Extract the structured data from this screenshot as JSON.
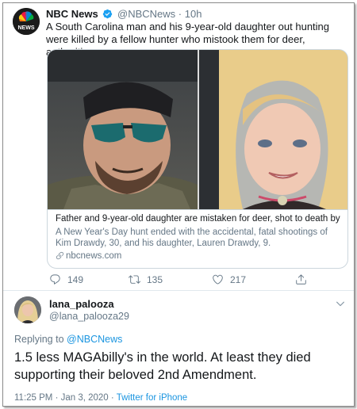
{
  "quoted_tweet": {
    "account_name": "NBC News",
    "handle": "@NBCNews",
    "separator": "·",
    "time": "10h",
    "logo_text": "NEWS",
    "text": "A South Carolina man and his 9-year-old daughter out hunting were killed by a fellow hunter who mistook them for deer, authorities say.",
    "card": {
      "title": "Father and 9-year-old daughter are mistaken for deer, shot to death by ...",
      "description": "A New Year's Day hunt ended with the accidental, fatal shootings of Kim Drawdy, 30, and his daughter, Lauren Drawdy, 9.",
      "link": "nbcnews.com"
    },
    "actions": {
      "replies": "149",
      "retweets": "135",
      "likes": "217"
    }
  },
  "reply_tweet": {
    "display_name": "lana_palooza",
    "handle": "@lana_palooza29",
    "replying_prefix": "Replying to",
    "replying_to": "@NBCNews",
    "text": "1.5 less MAGAbilly's in the world. At least they died supporting their beloved 2nd Amendment.",
    "timestamp": "11:25 PM · Jan 3, 2020 · ",
    "source": "Twitter for iPhone"
  },
  "colors": {
    "link_blue": "#1b95e0",
    "secondary_text": "#657786",
    "border": "#ccd6dd",
    "verified_blue": "#1da1f2"
  },
  "icons": [
    "nbc-peacock-icon",
    "verified-icon",
    "link-icon",
    "reply-icon",
    "retweet-icon",
    "like-icon",
    "share-icon",
    "chevron-down-icon"
  ]
}
